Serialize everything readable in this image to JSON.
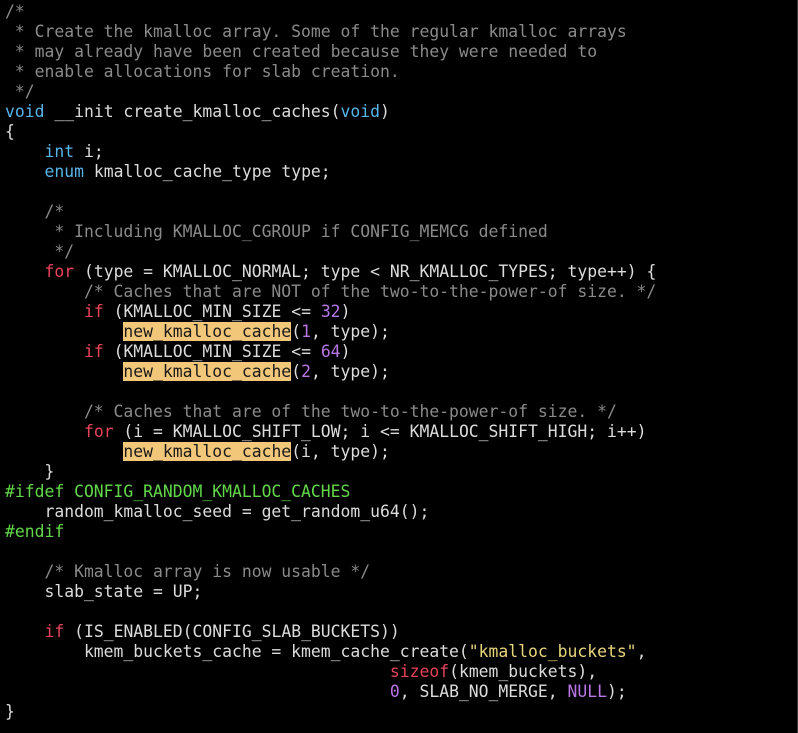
{
  "editor": {
    "colors": {
      "background": "#000000",
      "text": "#dcdcdc",
      "comment": "#8a8a8a",
      "keyword": "#56b6e8",
      "control": "#e8435a",
      "number": "#b877e6",
      "string": "#e8d67a",
      "preprocessor": "#62d84a",
      "search_highlight": "#f3c77a"
    },
    "lines": [
      [
        {
          "t": "comment",
          "s": "/*"
        }
      ],
      [
        {
          "t": "comment",
          "s": " * Create the kmalloc array. Some of the regular kmalloc arrays"
        }
      ],
      [
        {
          "t": "comment",
          "s": " * may already have been created because they were needed to"
        }
      ],
      [
        {
          "t": "comment",
          "s": " * enable allocations for slab creation."
        }
      ],
      [
        {
          "t": "comment",
          "s": " */"
        }
      ],
      [
        {
          "t": "keyword",
          "s": "void"
        },
        {
          "t": "ident",
          "s": " __init create_kmalloc_caches("
        },
        {
          "t": "keyword",
          "s": "void"
        },
        {
          "t": "ident",
          "s": ")"
        }
      ],
      [
        {
          "t": "ident",
          "s": "{"
        }
      ],
      [
        {
          "t": "ident",
          "s": "    "
        },
        {
          "t": "keyword",
          "s": "int"
        },
        {
          "t": "ident",
          "s": " i;"
        }
      ],
      [
        {
          "t": "ident",
          "s": "    "
        },
        {
          "t": "keyword",
          "s": "enum"
        },
        {
          "t": "ident",
          "s": " kmalloc_cache_type type;"
        }
      ],
      [
        {
          "t": "ident",
          "s": ""
        }
      ],
      [
        {
          "t": "comment",
          "s": "    /*"
        }
      ],
      [
        {
          "t": "comment",
          "s": "     * Including KMALLOC_CGROUP if CONFIG_MEMCG defined"
        }
      ],
      [
        {
          "t": "comment",
          "s": "     */"
        }
      ],
      [
        {
          "t": "ident",
          "s": "    "
        },
        {
          "t": "control",
          "s": "for"
        },
        {
          "t": "ident",
          "s": " (type = KMALLOC_NORMAL; type < NR_KMALLOC_TYPES; type++) {"
        }
      ],
      [
        {
          "t": "comment",
          "s": "        /* Caches that are NOT of the two-to-the-power-of size. */"
        }
      ],
      [
        {
          "t": "ident",
          "s": "        "
        },
        {
          "t": "control",
          "s": "if"
        },
        {
          "t": "ident",
          "s": " (KMALLOC_MIN_SIZE <= "
        },
        {
          "t": "number",
          "s": "32"
        },
        {
          "t": "ident",
          "s": ")"
        }
      ],
      [
        {
          "t": "ident",
          "s": "            "
        },
        {
          "t": "highlight",
          "s": "new_kmalloc_cache"
        },
        {
          "t": "ident",
          "s": "("
        },
        {
          "t": "number",
          "s": "1"
        },
        {
          "t": "ident",
          "s": ", type);"
        }
      ],
      [
        {
          "t": "ident",
          "s": "        "
        },
        {
          "t": "control",
          "s": "if"
        },
        {
          "t": "ident",
          "s": " (KMALLOC_MIN_SIZE <= "
        },
        {
          "t": "number",
          "s": "64"
        },
        {
          "t": "ident",
          "s": ")"
        }
      ],
      [
        {
          "t": "ident",
          "s": "            "
        },
        {
          "t": "highlight",
          "s": "new_kmalloc_cache"
        },
        {
          "t": "ident",
          "s": "("
        },
        {
          "t": "number",
          "s": "2"
        },
        {
          "t": "ident",
          "s": ", type);"
        }
      ],
      [
        {
          "t": "ident",
          "s": ""
        }
      ],
      [
        {
          "t": "comment",
          "s": "        /* Caches that are of the two-to-the-power-of size. */"
        }
      ],
      [
        {
          "t": "ident",
          "s": "        "
        },
        {
          "t": "control",
          "s": "for"
        },
        {
          "t": "ident",
          "s": " (i = KMALLOC_SHIFT_LOW; i <= KMALLOC_SHIFT_HIGH; i++)"
        }
      ],
      [
        {
          "t": "ident",
          "s": "            "
        },
        {
          "t": "highlight",
          "s": "new_kmalloc_cache"
        },
        {
          "t": "ident",
          "s": "(i, type);"
        }
      ],
      [
        {
          "t": "ident",
          "s": "    }"
        }
      ],
      [
        {
          "t": "preproc",
          "s": "#ifdef CONFIG_RANDOM_KMALLOC_CACHES"
        }
      ],
      [
        {
          "t": "ident",
          "s": "    random_kmalloc_seed = get_random_u64();"
        }
      ],
      [
        {
          "t": "preproc",
          "s": "#endif"
        }
      ],
      [
        {
          "t": "ident",
          "s": ""
        }
      ],
      [
        {
          "t": "comment",
          "s": "    /* Kmalloc array is now usable */"
        }
      ],
      [
        {
          "t": "ident",
          "s": "    slab_state = UP;"
        }
      ],
      [
        {
          "t": "ident",
          "s": ""
        }
      ],
      [
        {
          "t": "ident",
          "s": "    "
        },
        {
          "t": "control",
          "s": "if"
        },
        {
          "t": "ident",
          "s": " (IS_ENABLED(CONFIG_SLAB_BUCKETS))"
        }
      ],
      [
        {
          "t": "ident",
          "s": "        kmem_buckets_cache = kmem_cache_create("
        },
        {
          "t": "string",
          "s": "\"kmalloc_buckets\""
        },
        {
          "t": "ident",
          "s": ","
        }
      ],
      [
        {
          "t": "ident",
          "s": "                                       "
        },
        {
          "t": "control",
          "s": "sizeof"
        },
        {
          "t": "ident",
          "s": "(kmem_buckets),"
        }
      ],
      [
        {
          "t": "ident",
          "s": "                                       "
        },
        {
          "t": "number",
          "s": "0"
        },
        {
          "t": "ident",
          "s": ", SLAB_NO_MERGE, "
        },
        {
          "t": "number",
          "s": "NULL"
        },
        {
          "t": "ident",
          "s": ");"
        }
      ],
      [
        {
          "t": "ident",
          "s": "}"
        }
      ]
    ]
  }
}
